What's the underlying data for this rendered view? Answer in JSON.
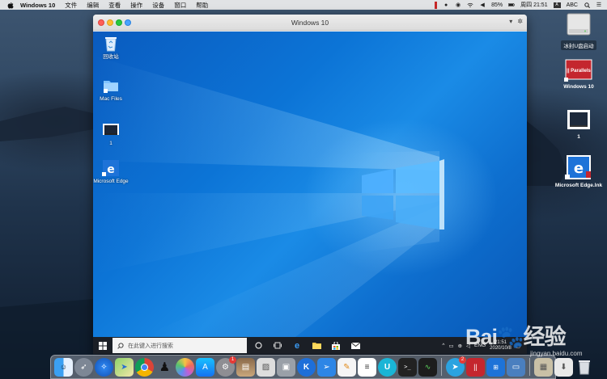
{
  "mac": {
    "menubar": {
      "app_name": "Windows 10",
      "items": [
        "文件",
        "编辑",
        "查看",
        "操作",
        "设备",
        "窗口",
        "帮助"
      ],
      "battery": "85%",
      "clock": "周四 21:51",
      "input_method": "ABC"
    },
    "desktop_icons": [
      {
        "label": "冰封U盘启动"
      },
      {
        "label": "Windows 10"
      },
      {
        "label": "1"
      },
      {
        "label": "Microsoft Edge.lnk"
      }
    ]
  },
  "vm_window": {
    "title": "Windows 10"
  },
  "windows": {
    "desktop_icons": [
      {
        "label": "回收站"
      },
      {
        "label": "Mac Files"
      },
      {
        "label": "1"
      },
      {
        "label": "Microsoft Edge"
      }
    ],
    "taskbar": {
      "search_placeholder": "在此键入进行搜索",
      "tray_lang": "ENG",
      "tray_time": "21:51",
      "tray_date": "2020/10/8"
    }
  },
  "dock": {
    "badges": {
      "telegram": "2",
      "prefs": "1"
    }
  },
  "watermark": {
    "brand": "Bai🐾经验",
    "url": "jingyan.baidu.com"
  },
  "colors": {
    "win_blue": "#0c74d6",
    "taskbar": "#1b1f26",
    "mac_close": "#fe5f57",
    "mac_min": "#febc2e",
    "mac_max": "#28c840"
  }
}
